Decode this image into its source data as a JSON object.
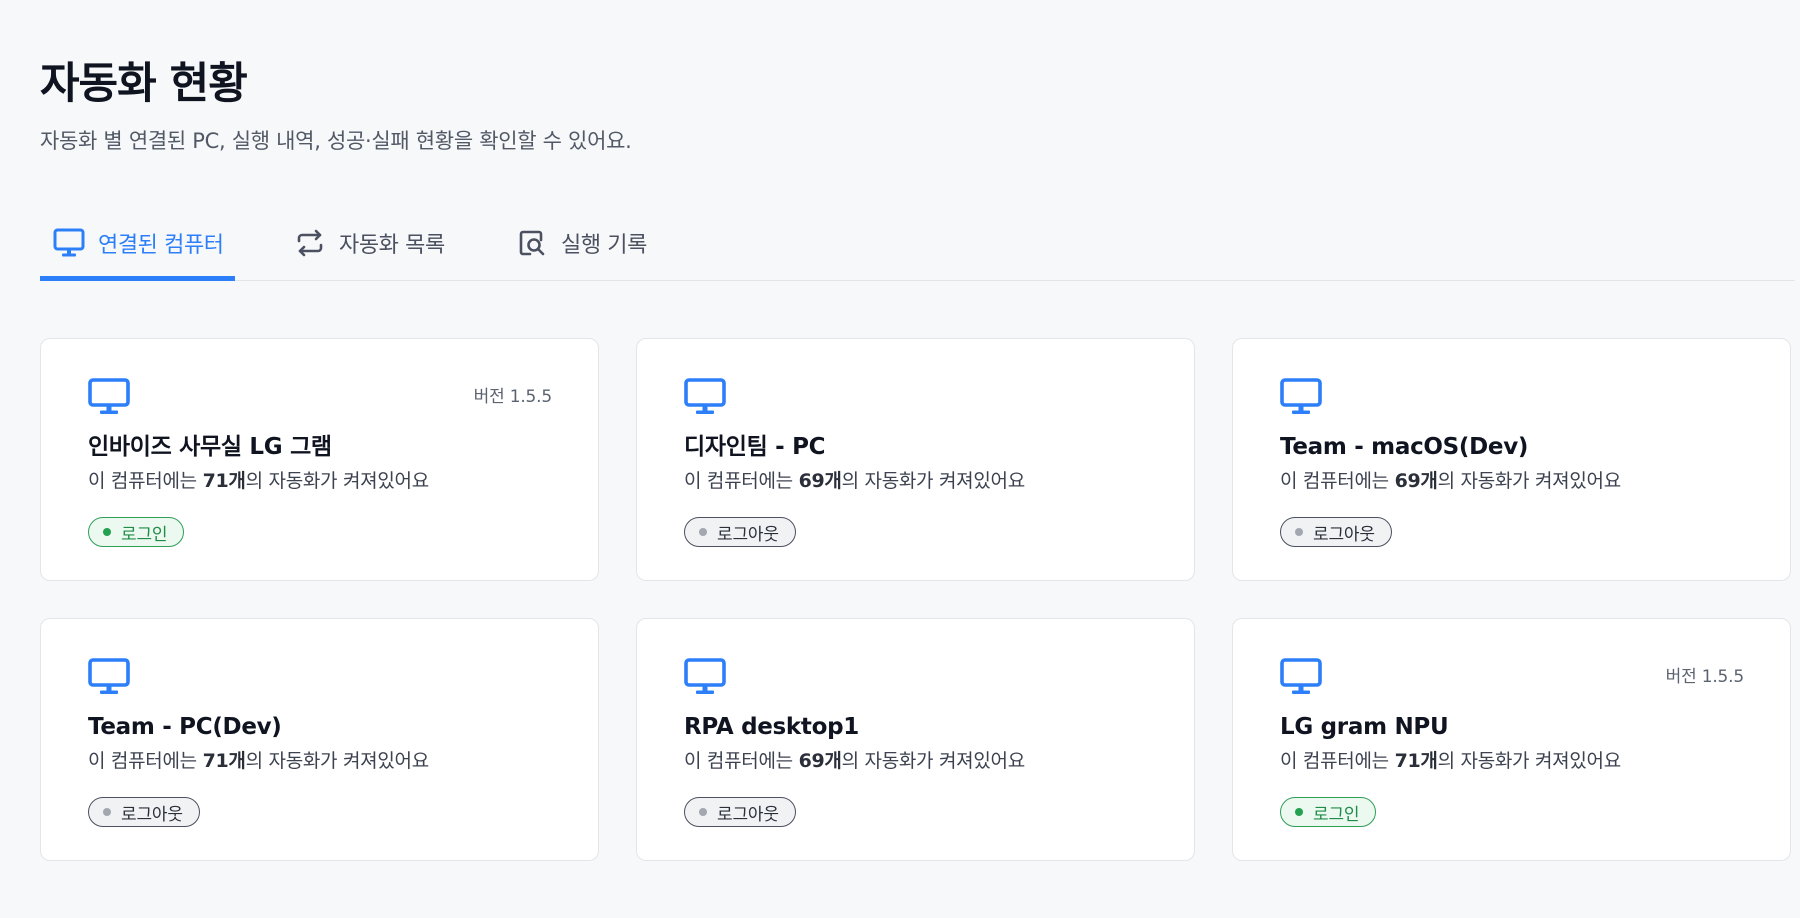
{
  "page": {
    "title": "자동화 현황",
    "subtitle": "자동화 별 연결된 PC, 실행 내역, 성공·실패 현황을 확인할 수 있어요."
  },
  "tabs": [
    {
      "label": "연결된 컴퓨터",
      "icon": "monitor-icon",
      "active": true
    },
    {
      "label": "자동화 목록",
      "icon": "repeat-icon",
      "active": false
    },
    {
      "label": "실행 기록",
      "icon": "search-log-icon",
      "active": false
    }
  ],
  "desc_template": {
    "prefix": "이 컴퓨터에는 ",
    "suffix": "의 자동화가 켜져있어요"
  },
  "computers": [
    {
      "name": "인바이즈 사무실 LG 그램",
      "version": "버전 1.5.5",
      "count": "71개",
      "status": "로그인",
      "online": true
    },
    {
      "name": "디자인팀 - PC",
      "version": "",
      "count": "69개",
      "status": "로그아웃",
      "online": false
    },
    {
      "name": "Team - macOS(Dev)",
      "version": "",
      "count": "69개",
      "status": "로그아웃",
      "online": false
    },
    {
      "name": "Team - PC(Dev)",
      "version": "",
      "count": "71개",
      "status": "로그아웃",
      "online": false
    },
    {
      "name": "RPA desktop1",
      "version": "",
      "count": "69개",
      "status": "로그아웃",
      "online": false
    },
    {
      "name": "LG gram NPU",
      "version": "버전 1.5.5",
      "count": "71개",
      "status": "로그인",
      "online": true
    }
  ],
  "colors": {
    "accent": "#2d7ff9",
    "online": "#24a150",
    "offline": "#a2a7b0",
    "background": "#f7f8fa"
  }
}
